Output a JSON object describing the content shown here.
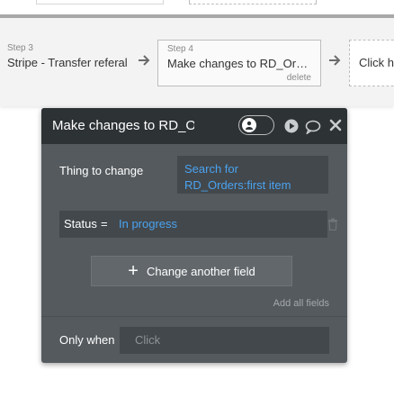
{
  "workflow": {
    "steps": [
      {
        "label": "Step 3",
        "title": "Stripe - Transfer referal"
      },
      {
        "label": "Step 4",
        "title": "Make changes to RD_Order...",
        "delete": "delete"
      },
      {
        "label": "",
        "title": "Click he"
      }
    ]
  },
  "panel": {
    "title": "Make changes to RD_Ord",
    "thing_to_change_label": "Thing to change",
    "thing_to_change_value": "Search for RD_Orders:first item",
    "field": {
      "name": "Status",
      "operator": "=",
      "value": "In progress"
    },
    "change_another_field": "Change another field",
    "add_all_fields": "Add all fields",
    "only_when_label": "Only when",
    "only_when_placeholder": "Click"
  },
  "colors": {
    "panel_bg": "#555a5e",
    "header_bg": "#2d3235",
    "link_blue": "#4aa3f0"
  },
  "icons": [
    "user-icon",
    "play-icon",
    "comment-icon",
    "close-icon",
    "trash-icon",
    "plus-icon",
    "arrow-right-icon"
  ]
}
